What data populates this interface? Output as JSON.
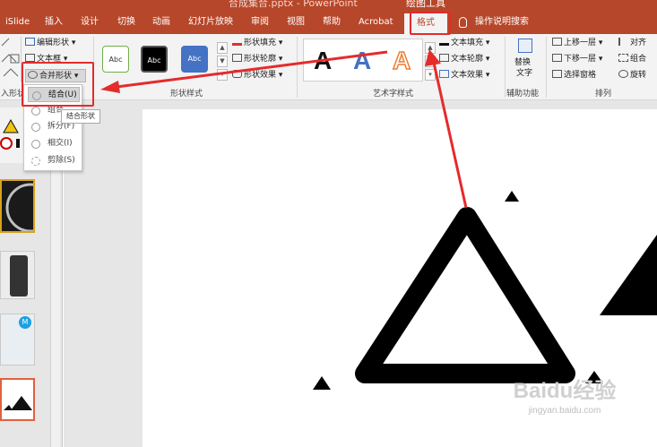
{
  "window": {
    "doc_title": "合成集合.pptx - PowerPoint",
    "context_title": "绘图工具"
  },
  "tabs": [
    "iSlide",
    "插入",
    "设计",
    "切换",
    "动画",
    "幻灯片放映",
    "审阅",
    "视图",
    "帮助",
    "Acrobat",
    "格式",
    "操作说明搜索"
  ],
  "insert_shapes": {
    "edit_shape": "编辑形状",
    "text_box": "文本框",
    "merge_shapes": "合并形状",
    "group_label": "入形状"
  },
  "shape_styles": {
    "swatches": [
      "Abc",
      "Abc",
      "Abc"
    ],
    "fill": "形状填充",
    "outline": "形状轮廓",
    "effects": "形状效果",
    "group_label": "形状样式"
  },
  "wordart": {
    "letters": [
      "A",
      "A",
      "A"
    ],
    "text_fill": "文本填充",
    "text_outline": "文本轮廓",
    "text_effects": "文本效果",
    "group_label": "艺术字样式"
  },
  "accessibility": {
    "alt_text": [
      "替换",
      "文字"
    ],
    "group_label": "辅助功能"
  },
  "arrange": {
    "bring_forward": "上移一层",
    "send_backward": "下移一层",
    "selection_pane": "选择窗格",
    "align": "对齐",
    "group": "组合",
    "rotate": "旋转",
    "group_label": "排列"
  },
  "merge_menu": {
    "items": [
      "结合(U)",
      "组合",
      "拆分(F)",
      "相交(I)",
      "剪除(S)"
    ],
    "tooltip": "结合形状"
  },
  "thumbnail_badge": "M",
  "watermark": {
    "logo": "Baidu经验",
    "url": "jingyan.baidu.com"
  },
  "colors": {
    "accent": "#b7472a",
    "highlight": "#e52b2b",
    "wordart_blue": "#4472c4",
    "wordart_orange": "#ed7d31",
    "swatch_blue": "#4472c4",
    "badge": "#1ba1e2"
  }
}
